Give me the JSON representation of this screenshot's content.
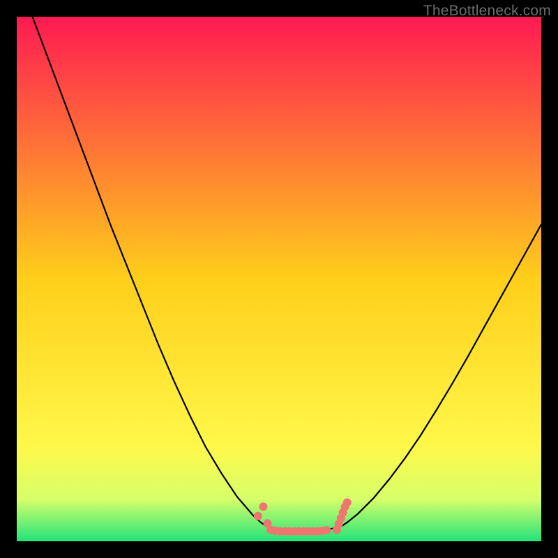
{
  "watermark": "TheBottleneck.com",
  "chart_data": {
    "type": "line",
    "title": "",
    "xlabel": "",
    "ylabel": "",
    "xlim": [
      0,
      100
    ],
    "ylim": [
      0,
      100
    ],
    "grid": false,
    "legend": false,
    "background_gradient": {
      "stops": [
        {
          "offset": 0.0,
          "color": "#ff1a52"
        },
        {
          "offset": 0.5,
          "color": "#ffcf1a"
        },
        {
          "offset": 0.82,
          "color": "#fff84a"
        },
        {
          "offset": 0.92,
          "color": "#d7ff6a"
        },
        {
          "offset": 1.0,
          "color": "#22e37a"
        }
      ]
    },
    "series": [
      {
        "name": "left-curve",
        "stroke": "#000000",
        "x": [
          3,
          6,
          9,
          12,
          15,
          18,
          21,
          24,
          27,
          30,
          33,
          36,
          39,
          42,
          45,
          46.5,
          48
        ],
        "y": [
          100,
          92,
          84,
          76,
          68,
          60,
          52.5,
          45,
          37.5,
          30.5,
          24,
          18,
          13,
          8.5,
          5,
          3.6,
          2.6
        ]
      },
      {
        "name": "right-curve",
        "stroke": "#000000",
        "x": [
          61.5,
          63,
          65,
          68,
          71,
          74,
          77,
          80,
          83,
          86,
          89,
          92,
          95,
          98,
          100
        ],
        "y": [
          2.6,
          3.6,
          5.2,
          8.2,
          11.8,
          15.8,
          20.2,
          25,
          30,
          35.2,
          40.6,
          46,
          51.4,
          56.8,
          60.4
        ]
      },
      {
        "name": "bottom-flat",
        "stroke": "#000000",
        "x": [
          48,
          50,
          52,
          54,
          56,
          58,
          60,
          61.5
        ],
        "y": [
          2.6,
          2.3,
          2.2,
          2.2,
          2.2,
          2.3,
          2.4,
          2.6
        ]
      }
    ],
    "markers": [
      {
        "name": "left-marker-1",
        "cx": 46.0,
        "cy": 4.8
      },
      {
        "name": "left-marker-2",
        "cx": 47.0,
        "cy": 6.6
      },
      {
        "name": "left-marker-3",
        "cx": 47.8,
        "cy": 3.4
      },
      {
        "name": "left-marker-4",
        "cx": 48.4,
        "cy": 2.2
      },
      {
        "name": "left-marker-5",
        "cx": 49.3,
        "cy": 2.0
      },
      {
        "name": "left-marker-6",
        "cx": 50.2,
        "cy": 1.9
      },
      {
        "name": "left-marker-7",
        "cx": 51.1,
        "cy": 1.9
      },
      {
        "name": "left-marker-8",
        "cx": 52.0,
        "cy": 1.9
      },
      {
        "name": "left-marker-9",
        "cx": 52.9,
        "cy": 1.9
      },
      {
        "name": "left-marker-10",
        "cx": 53.8,
        "cy": 1.9
      },
      {
        "name": "left-marker-11",
        "cx": 54.7,
        "cy": 1.9
      },
      {
        "name": "left-marker-12",
        "cx": 55.6,
        "cy": 1.9
      },
      {
        "name": "left-marker-13",
        "cx": 56.5,
        "cy": 1.9
      },
      {
        "name": "left-marker-14",
        "cx": 57.4,
        "cy": 1.9
      },
      {
        "name": "left-marker-15",
        "cx": 58.3,
        "cy": 2.0
      },
      {
        "name": "left-marker-16",
        "cx": 59.1,
        "cy": 2.1
      },
      {
        "name": "right-marker-1",
        "cx": 61.0,
        "cy": 2.2
      },
      {
        "name": "right-marker-2",
        "cx": 61.4,
        "cy": 3.3
      },
      {
        "name": "right-marker-3",
        "cx": 61.8,
        "cy": 4.4
      },
      {
        "name": "right-marker-4",
        "cx": 62.2,
        "cy": 5.5
      },
      {
        "name": "right-marker-5",
        "cx": 62.6,
        "cy": 6.6
      },
      {
        "name": "right-marker-6",
        "cx": 63.0,
        "cy": 7.4
      }
    ],
    "marker_style": {
      "fill": "#ef7670",
      "radius_px": 6
    }
  }
}
